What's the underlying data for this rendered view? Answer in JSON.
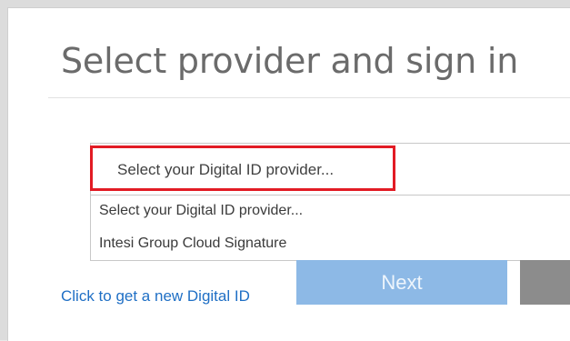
{
  "dialog": {
    "title": "Select provider and sign in"
  },
  "provider_select": {
    "selected_value": "Select your Digital ID provider...",
    "options": [
      "Select your Digital ID provider...",
      "Intesi Group Cloud Signature"
    ]
  },
  "links": {
    "get_new_id": "Click to get a new Digital ID"
  },
  "buttons": {
    "next_label": "Next"
  },
  "colors": {
    "highlight": "#e21b24",
    "primary_button": "#8db9e6",
    "secondary_button": "#8c8c8c",
    "link": "#1f6fc5"
  }
}
